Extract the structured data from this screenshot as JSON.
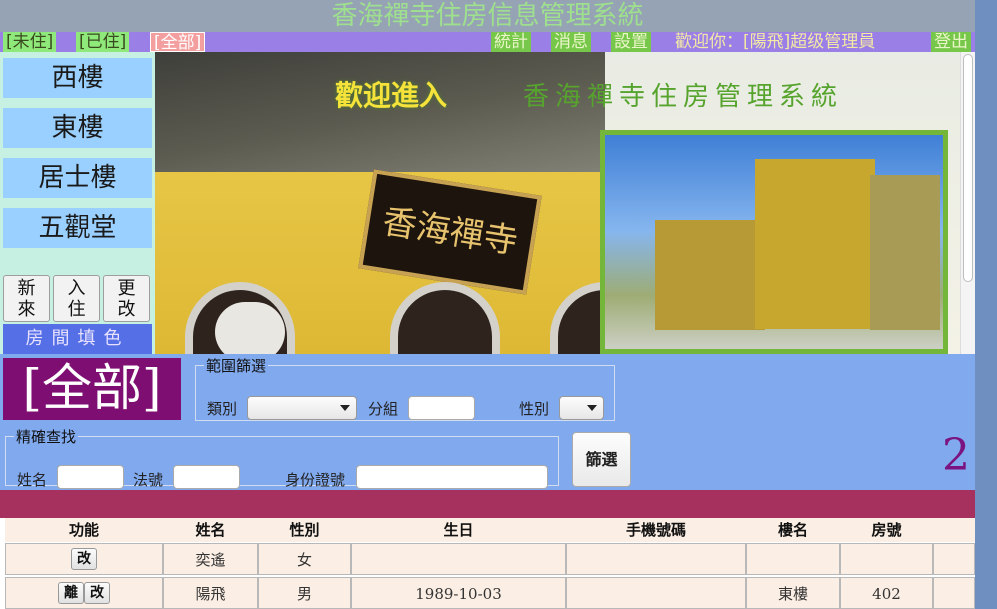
{
  "app_title": "香海禪寺住房信息管理系統",
  "top_menu": {
    "status_tabs": [
      "[未住]",
      "[已住]",
      "[全部]"
    ],
    "stats": "統計",
    "messages": "消息",
    "settings": "設置",
    "welcome": "歡迎你：[陽飛]超级管理員",
    "logout": "登出"
  },
  "sidebar": {
    "buildings": [
      "西樓",
      "東樓",
      "居士樓",
      "五觀堂"
    ],
    "actions": [
      {
        "label": "新來"
      },
      {
        "label": "入住"
      },
      {
        "label": "更改"
      }
    ],
    "fill_color": "房間填色"
  },
  "banner": {
    "welcome": "歡迎進入",
    "title": "香海禪寺住房管理系統",
    "plaque": "香海禪寺"
  },
  "filter": {
    "current_view": "[全部]",
    "range_legend": "範圍篩選",
    "category_label": "類別",
    "group_label": "分組",
    "gender_label": "性別",
    "exact_legend": "精確查找",
    "name_label": "姓名",
    "dharma_label": "法號",
    "id_label": "身份證號",
    "filter_button": "篩選",
    "count": "2"
  },
  "table": {
    "columns": [
      "功能",
      "姓名",
      "性別",
      "生日",
      "手機號碼",
      "樓名",
      "房號"
    ],
    "rows": [
      {
        "actions": [
          "改"
        ],
        "name": "奕遙",
        "gender": "女",
        "birthday": "",
        "phone": "",
        "building": "",
        "room": ""
      },
      {
        "actions": [
          "離",
          "改"
        ],
        "name": "陽飛",
        "gender": "男",
        "birthday": "1989-10-03",
        "phone": "",
        "building": "東樓",
        "room": "402"
      }
    ]
  }
}
